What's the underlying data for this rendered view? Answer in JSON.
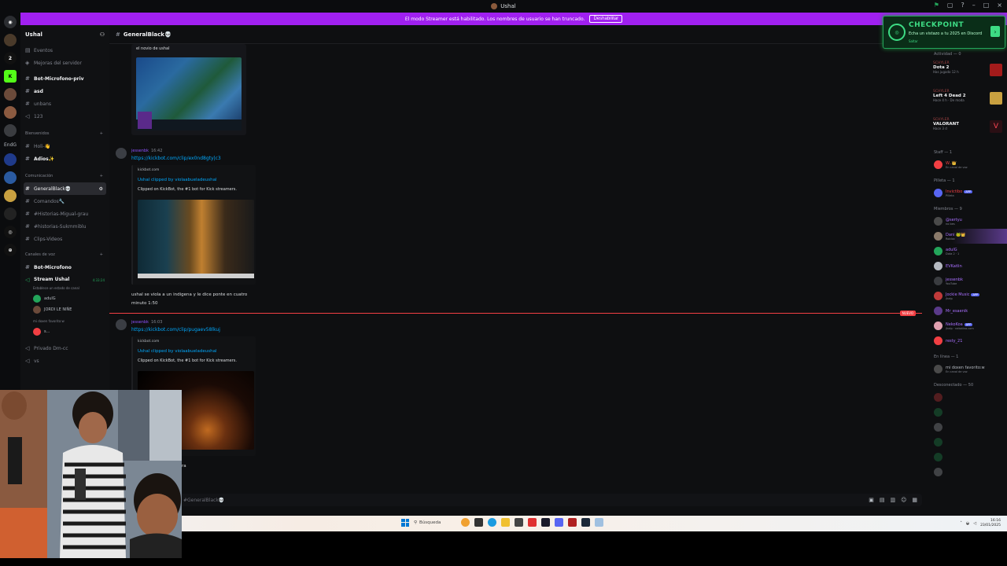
{
  "window": {
    "title": "Ushal"
  },
  "banner": {
    "text": "El modo Streamer está habilitado. Los nombres de usuario se han truncado.",
    "button": "Deshabilitar"
  },
  "rail": {
    "label_1": "EndG"
  },
  "server": {
    "name": "Ushal"
  },
  "sidebar": {
    "top_items": [
      "Eventos",
      "Mejoras del servidor"
    ],
    "channels_a": [
      {
        "name": "Bot-Microfono-priv",
        "bold": true
      },
      {
        "name": "asd",
        "bold": true
      },
      {
        "name": "unbans",
        "bold": false
      },
      {
        "name": "123",
        "bold": false
      }
    ],
    "cat_bienvenidos": "Bienvenidos",
    "channels_b": [
      {
        "name": "Holi-👋",
        "bold": false
      },
      {
        "name": "Adios✨",
        "bold": true
      }
    ],
    "cat_comunicacion": "Comunicación",
    "channels_c": [
      {
        "name": "GeneralBlack💀",
        "selected": true
      },
      {
        "name": "Comandos🔧",
        "selected": false
      },
      {
        "name": "#Historias-Migual-grau",
        "selected": false
      },
      {
        "name": "#historias-Sukmmiblu",
        "selected": false
      },
      {
        "name": "Clips-Videos",
        "selected": false
      }
    ],
    "cat_voz": "Canales de voz",
    "voice_channels": {
      "first": "Bot-Microfono",
      "stream": "Stream Ushal",
      "stream_time": "4:33:24",
      "stream_status": "Establece un estado de canal",
      "users": [
        "adulG",
        "JORDI LE NIÑE",
        "mi doxen favorito:w",
        "s..."
      ],
      "other": [
        "Privado Dm-cc",
        "vs"
      ]
    }
  },
  "channel": {
    "name": "GeneralBlack💀"
  },
  "messages": [
    {
      "caption": "el novio de ushal"
    },
    {
      "author": "jessenbk",
      "time": "16:42",
      "link": "https://kickbot.com/clip/ex0nd8gty|c3",
      "embed_site": "kickbot.com",
      "embed_title": "Ushal clipped by violaabueladeushal",
      "embed_desc": "Clipped on KickBot, the #1 bot for Kick streamers.",
      "text_1": "ushal se viola a un indigena y le dice ponte en cuatro",
      "text_2": "minuto 1:50"
    },
    {
      "author": "jessenbk",
      "time": "16:03",
      "link": "https://kickbot.com/clip/pugaev58lkuj",
      "embed_site": "kickbot.com",
      "embed_title": "Ushal clipped by violaabueladeushal",
      "embed_desc": "Clipped on KickBot, the #1 bot for Kick streamers.",
      "text_1": "ra"
    }
  ],
  "new_badge": "NUEVO",
  "input": {
    "placeholder": "#GeneralBlack💀"
  },
  "members": {
    "activity_header": "Actividad — 0",
    "activities": [
      {
        "mini": "SCHYLER",
        "game": "Dota 2",
        "sub": "Has jugado 12 h"
      },
      {
        "mini": "SCHYLER",
        "game": "Left 4 Dead 2",
        "sub": "Hace 4 h · De moda"
      },
      {
        "mini": "SCHYLER",
        "game": "VALORANT",
        "sub": "Hace 3 d"
      }
    ],
    "groups": [
      {
        "title": "Staff — 1",
        "members": [
          {
            "name": "W..👑",
            "status": "En canal de voz",
            "color": "#f23f43"
          }
        ]
      },
      {
        "title": "Pilleta — 1",
        "members": [
          {
            "name": "Invictibo",
            "status": "Pilleta",
            "color": "#f23f43",
            "tag": "APP"
          }
        ]
      },
      {
        "title": "Miembros — 9",
        "members": [
          {
            "name": "@sertyu",
            "status": "no bes",
            "color": "#a970ff"
          },
          {
            "name": "Dani 🐸👑",
            "status": "Roblox",
            "color": "#a970ff"
          },
          {
            "name": "adulG",
            "status": "Dota 2 · 1",
            "color": "#a970ff"
          },
          {
            "name": "EVKatlin",
            "status": "",
            "color": "#a970ff"
          },
          {
            "name": "jessenbk",
            "status": "YouTube",
            "color": "#a970ff"
          },
          {
            "name": "Jockie Music",
            "status": "/help",
            "color": "#a970ff",
            "tag": "APP"
          },
          {
            "name": "Mr_esaenik",
            "status": "",
            "color": "#a970ff"
          },
          {
            "name": "NekoKoa",
            "status": "/help · nekotina.com",
            "color": "#a970ff",
            "tag": "APP"
          },
          {
            "name": "resty_21",
            "status": "",
            "color": "#a970ff"
          }
        ]
      },
      {
        "title": "En línea — 1",
        "members": [
          {
            "name": "mi doxen favorito:w",
            "status": "En canal de voz",
            "color": "#b5bac1"
          }
        ]
      }
    ],
    "offline_header": "Desconectado — 50"
  },
  "checkpoint": {
    "title": "CHECKPOINT",
    "subtitle": "Echa un vistazo a tu 2025 en Discord",
    "link": "Saltar"
  },
  "taskbar": {
    "search": "Búsqueda",
    "time": "16:16",
    "date": "23/01/2025"
  }
}
